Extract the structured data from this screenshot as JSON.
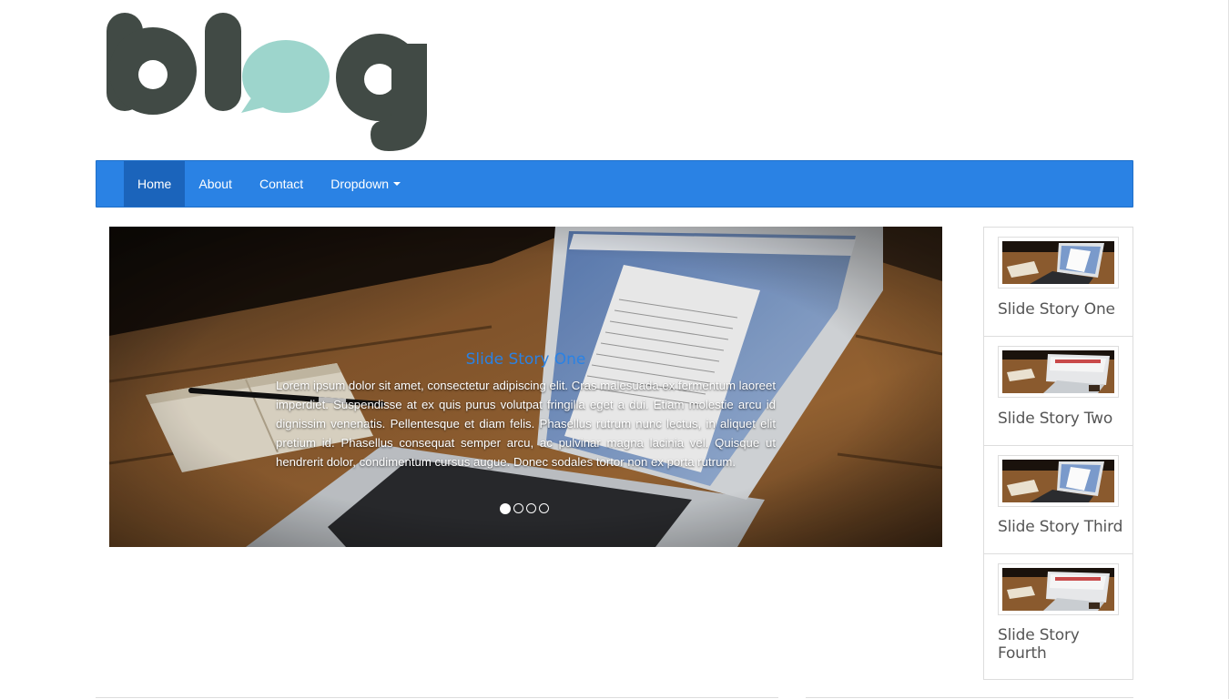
{
  "header": {
    "logo_text": "blog",
    "logo_icon": "speech-bubble-o-icon"
  },
  "navbar": {
    "items": [
      {
        "label": "Home",
        "active": true
      },
      {
        "label": "About",
        "active": false
      },
      {
        "label": "Contact",
        "active": false
      },
      {
        "label": "Dropdown",
        "active": false,
        "icon": "caret-down-icon"
      }
    ],
    "background": "#2a82e4",
    "active_background": "#1b64bb"
  },
  "carousel": {
    "caption_title": "Slide Story One",
    "caption_text": "Lorem ipsum dolor sit amet, consectetur adipiscing elit. Cras malesuada ex fermentum laoreet imperdiet. Suspendisse at ex quis purus volutpat fringilla eget a dui. Etiam molestie arcu id dignissim venenatis. Pellentesque et diam felis. Phasellus rutrum nunc lectus, in aliquet elit pretium id. Phasellus consequat semper arcu, ac pulvinar magna lacinia vel. Quisque ut hendrerit dolor, condimentum cursus augue. Donec sodales tortor non ex porta rutrum.",
    "slide_count": 4,
    "active_slide": 1,
    "accent_color": "#2a82e4"
  },
  "sidebar": {
    "items": [
      {
        "label": "Slide Story One",
        "thumb": "laptop-document"
      },
      {
        "label": "Slide Story Two",
        "thumb": "laptop-website"
      },
      {
        "label": "Slide Story Third",
        "thumb": "laptop-document"
      },
      {
        "label": "Slide Story Fourth",
        "thumb": "laptop-website"
      }
    ]
  }
}
